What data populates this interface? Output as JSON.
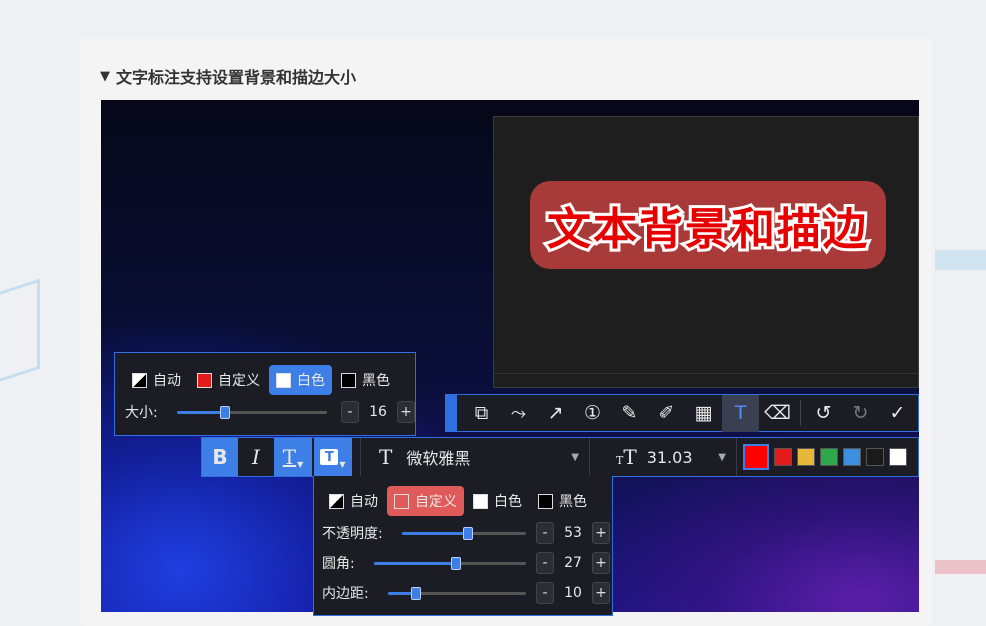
{
  "section": {
    "title": "文字标注支持设置背景和描边大小",
    "toggle_glyph": "▼"
  },
  "preview": {
    "text": "文本背景和描边",
    "text_color": "#e60000",
    "background_color": "#a83a3a",
    "stroke_color": "#ffffff"
  },
  "stroke_panel": {
    "options": [
      {
        "label": "自动",
        "swatch": "auto",
        "active": false
      },
      {
        "label": "自定义",
        "swatch": "#e31b1b",
        "active": false
      },
      {
        "label": "白色",
        "swatch": "#ffffff",
        "active": true
      },
      {
        "label": "黑色",
        "swatch": "#000000",
        "active": false
      }
    ],
    "size_label": "大小:",
    "size_value": "16",
    "size_fraction": 0.32,
    "minus": "-",
    "plus": "+"
  },
  "toolbar": {
    "tools": [
      {
        "name": "shape-tool-icon",
        "glyph": "⧉"
      },
      {
        "name": "curve-tool-icon",
        "glyph": "⤳"
      },
      {
        "name": "arrow-tool-icon",
        "glyph": "↗"
      },
      {
        "name": "number-marker-icon",
        "glyph": "①"
      },
      {
        "name": "pencil-icon",
        "glyph": "✎"
      },
      {
        "name": "highlighter-icon",
        "glyph": "✐"
      },
      {
        "name": "mosaic-icon",
        "glyph": "▦"
      },
      {
        "name": "text-tool-icon",
        "glyph": "T",
        "active": true
      },
      {
        "name": "eraser-icon",
        "glyph": "⌫"
      }
    ],
    "undo_glyph": "↺",
    "redo_glyph": "↻",
    "confirm_glyph": "✓"
  },
  "format_bar": {
    "bold": "B",
    "italic": "I",
    "stroke_glyph": "T",
    "background_glyph": "T",
    "font_glyph": "T",
    "font_name": "微软雅黑",
    "size_glyph_small": "T",
    "size_glyph_big": "T",
    "font_size": "31.03",
    "current_color": "#ff0000",
    "palette": [
      "#e31b1b",
      "#e6b83a",
      "#2ea84a",
      "#3d8fe0",
      "#1a1a1a",
      "#ffffff"
    ]
  },
  "background_panel": {
    "options": [
      {
        "label": "自动",
        "swatch": "auto",
        "active": false
      },
      {
        "label": "自定义",
        "swatch": "#e05a5a",
        "active": true
      },
      {
        "label": "白色",
        "swatch": "#ffffff",
        "active": false
      },
      {
        "label": "黑色",
        "swatch": "#000000",
        "active": false
      }
    ],
    "opacity_label": "不透明度:",
    "opacity_value": "53",
    "opacity_fraction": 0.53,
    "radius_label": "圆角:",
    "radius_value": "27",
    "radius_fraction": 0.54,
    "padding_label": "内边距:",
    "padding_value": "10",
    "padding_fraction": 0.2,
    "minus": "-",
    "plus": "+"
  }
}
